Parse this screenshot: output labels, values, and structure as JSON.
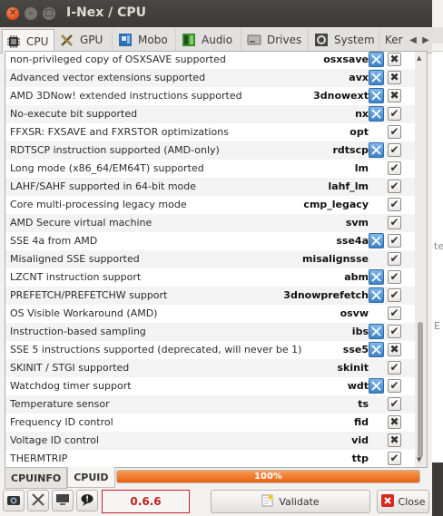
{
  "window": {
    "title": "I-Nex / CPU"
  },
  "tabs": [
    {
      "label": "CPU",
      "icon": "cpu-icon"
    },
    {
      "label": "GPU",
      "icon": "gpu-icon"
    },
    {
      "label": "Mobo",
      "icon": "mobo-icon"
    },
    {
      "label": "Audio",
      "icon": "audio-icon"
    },
    {
      "label": "Drives",
      "icon": "drives-icon"
    },
    {
      "label": "System",
      "icon": "system-icon"
    },
    {
      "label": "Ker",
      "icon": "kernel-icon"
    }
  ],
  "flags": [
    {
      "desc": "non-privileged copy of OSXSAVE supported",
      "flag": "osxsave",
      "os": true,
      "state": "x"
    },
    {
      "desc": "Advanced vector extensions supported",
      "flag": "avx",
      "os": true,
      "state": "x"
    },
    {
      "desc": "AMD 3DNow! extended instructions supported",
      "flag": "3dnowext",
      "os": true,
      "state": "x"
    },
    {
      "desc": "No-execute bit supported",
      "flag": "nx",
      "os": true,
      "state": "check"
    },
    {
      "desc": "FFXSR: FXSAVE and FXRSTOR optimizations",
      "flag": "opt",
      "os": false,
      "state": "check"
    },
    {
      "desc": "RDTSCP instruction supported (AMD-only)",
      "flag": "rdtscp",
      "os": true,
      "state": "check"
    },
    {
      "desc": "Long mode (x86_64/EM64T) supported",
      "flag": "lm",
      "os": false,
      "state": "check"
    },
    {
      "desc": "LAHF/SAHF supported in 64-bit mode",
      "flag": "lahf_lm",
      "os": false,
      "state": "check"
    },
    {
      "desc": "Core multi-processing legacy mode",
      "flag": "cmp_legacy",
      "os": false,
      "state": "check"
    },
    {
      "desc": "AMD Secure virtual machine",
      "flag": "svm",
      "os": false,
      "state": "check"
    },
    {
      "desc": "SSE 4a from AMD",
      "flag": "sse4a",
      "os": true,
      "state": "check"
    },
    {
      "desc": "Misaligned SSE supported",
      "flag": "misalignsse",
      "os": false,
      "state": "check"
    },
    {
      "desc": "LZCNT instruction support",
      "flag": "abm",
      "os": true,
      "state": "check"
    },
    {
      "desc": "PREFETCH/PREFETCHW support",
      "flag": "3dnowprefetch",
      "os": true,
      "state": "check"
    },
    {
      "desc": "OS Visible Workaround (AMD)",
      "flag": "osvw",
      "os": false,
      "state": "check"
    },
    {
      "desc": "Instruction-based sampling",
      "flag": "ibs",
      "os": true,
      "state": "check"
    },
    {
      "desc": "SSE 5 instructions supported (deprecated, will never be 1)",
      "flag": "sse5",
      "os": true,
      "state": "x"
    },
    {
      "desc": "SKINIT / STGI supported",
      "flag": "skinit",
      "os": false,
      "state": "check"
    },
    {
      "desc": "Watchdog timer support",
      "flag": "wdt",
      "os": true,
      "state": "check"
    },
    {
      "desc": "Temperature sensor",
      "flag": "ts",
      "os": false,
      "state": "check"
    },
    {
      "desc": "Frequency ID control",
      "flag": "fid",
      "os": false,
      "state": "x"
    },
    {
      "desc": "Voltage ID control",
      "flag": "vid",
      "os": false,
      "state": "x"
    },
    {
      "desc": "THERMTRIP",
      "flag": "ttp",
      "os": false,
      "state": "check"
    }
  ],
  "bottom_tabs": [
    {
      "label": "CPUINFO"
    },
    {
      "label": "CPUID"
    }
  ],
  "progress": {
    "label": "100%",
    "value": 1.0
  },
  "toolbar": {
    "version": "0.6.6",
    "validate_label": "Validate",
    "close_label": "Close"
  },
  "side": {
    "t1": "te",
    "t2": "E"
  },
  "colors": {
    "progress": "#e9620f",
    "version": "#c0211b",
    "close_icon": "#d42a1f"
  }
}
